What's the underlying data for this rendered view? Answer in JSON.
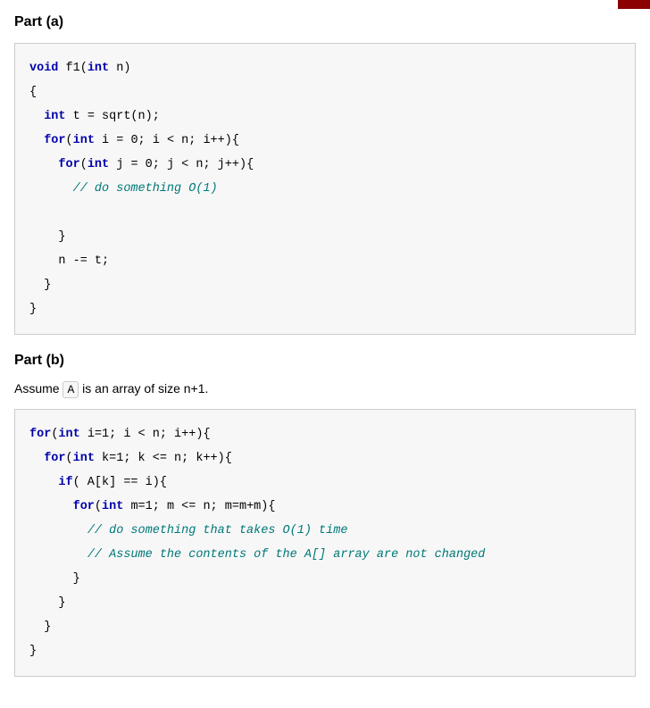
{
  "part_a": {
    "heading": "Part (a)",
    "code": {
      "l1_kw": "void",
      "l1_rest": " f1(",
      "l1_kw2": "int",
      "l1_rest2": " n)",
      "l2": "{",
      "l3_pre": "  ",
      "l3_kw": "int",
      "l3_rest": " t = sqrt(n);",
      "l4_pre": "  ",
      "l4_kw": "for",
      "l4_rest": "(",
      "l4_kw2": "int",
      "l4_rest2": " i = 0; i < n; i++){",
      "l5_pre": "    ",
      "l5_kw": "for",
      "l5_rest": "(",
      "l5_kw2": "int",
      "l5_rest2": " j = 0; j < n; j++){",
      "l6_pre": "      ",
      "l6_comment": "// do something O(1)",
      "l7": "",
      "l8": "    }",
      "l9": "    n -= t;",
      "l10": "  }",
      "l11": "}"
    }
  },
  "part_b": {
    "heading": "Part (b)",
    "description_pre": "Assume ",
    "description_code": "A",
    "description_post": " is an array of size n+1.",
    "code": {
      "l1_kw": "for",
      "l1_rest": "(",
      "l1_kw2": "int",
      "l1_rest2": " i=1; i < n; i++){",
      "l2_pre": "  ",
      "l2_kw": "for",
      "l2_rest": "(",
      "l2_kw2": "int",
      "l2_rest2": " k=1; k <= n; k++){",
      "l3_pre": "    ",
      "l3_kw": "if",
      "l3_rest": "( A[k] == i){",
      "l4_pre": "      ",
      "l4_kw": "for",
      "l4_rest": "(",
      "l4_kw2": "int",
      "l4_rest2": " m=1; m <= n; m=m+m){",
      "l5_pre": "        ",
      "l5_comment": "// do something that takes O(1) time",
      "l6_pre": "        ",
      "l6_comment": "// Assume the contents of the A[] array are not changed",
      "l7": "      }",
      "l8": "    }",
      "l9": "  }",
      "l10": "}"
    }
  }
}
